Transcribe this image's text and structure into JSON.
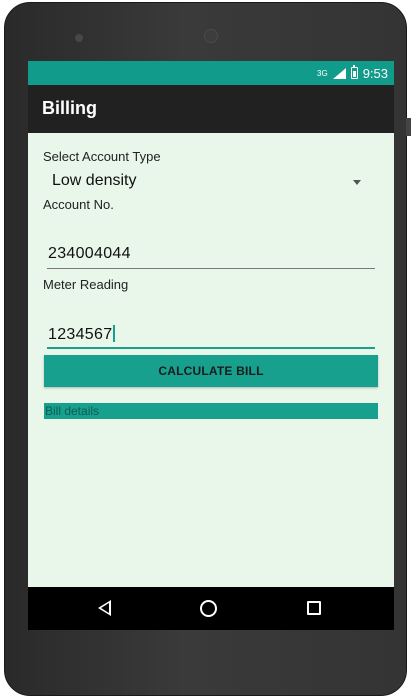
{
  "status_bar": {
    "network": "3G",
    "time": "9:53",
    "color": "#119b8a"
  },
  "app_bar": {
    "title": "Billing",
    "color": "#212121"
  },
  "form": {
    "account_type_label": "Select Account Type",
    "account_type_value": "Low density",
    "account_no_label": "Account No.",
    "account_no_value": "234004044",
    "meter_reading_label": "Meter Reading",
    "meter_reading_value": "1234567",
    "calculate_button_label": "CALCULATE BILL",
    "bill_details_text": "Bill details"
  },
  "theme": {
    "accent": "#16a08d",
    "background": "#e9f6ea"
  },
  "nav_bar": {
    "icons": [
      "back-icon",
      "home-icon",
      "recents-icon"
    ]
  }
}
